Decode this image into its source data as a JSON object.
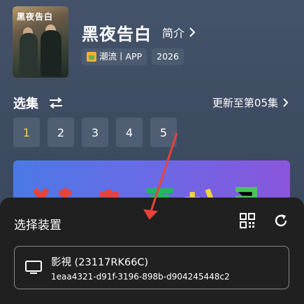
{
  "show": {
    "title": "黑夜告白",
    "poster_text": "黑夜告白",
    "intro_label": "简介",
    "tags": [
      "潮流丨APP",
      "2026"
    ]
  },
  "episodes": {
    "section_title": "选集",
    "update_text": "更新至第05集",
    "items": [
      "1",
      "2",
      "3",
      "4",
      "5"
    ],
    "selected": "1"
  },
  "device_sheet": {
    "title": "选择装置",
    "devices": [
      {
        "name": "影視 (23117RK66C)",
        "id": "1eaa4321-d91f-3196-898b-d904245448c2"
      }
    ]
  },
  "colors": {
    "background": "#3b4a60",
    "sheet": "#202020",
    "accent_selected": "#f5d04a",
    "arrow": "#e8423a"
  }
}
